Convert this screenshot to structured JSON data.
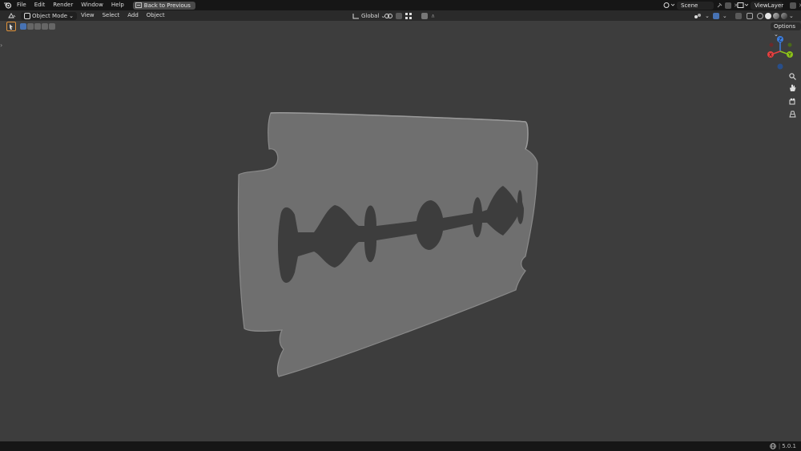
{
  "menu": {
    "items": [
      "File",
      "Edit",
      "Render",
      "Window",
      "Help"
    ],
    "back_button": "Back to Previous"
  },
  "scene": {
    "label": "Scene"
  },
  "viewlayer": {
    "label": "ViewLayer"
  },
  "header": {
    "mode": "Object Mode",
    "menus": [
      "View",
      "Select",
      "Add",
      "Object"
    ],
    "orientation": "Global"
  },
  "viewport": {
    "options_label": "Options",
    "gizmo": {
      "z": "Z",
      "y": "Y",
      "x": "X"
    }
  },
  "status": {
    "version": "5.0.1"
  },
  "colors": {
    "accent": "#4772b3",
    "axis_x": "#e64040",
    "axis_y": "#8cc21a",
    "axis_z": "#3d7fe0",
    "active_tool": "#e0923a"
  }
}
